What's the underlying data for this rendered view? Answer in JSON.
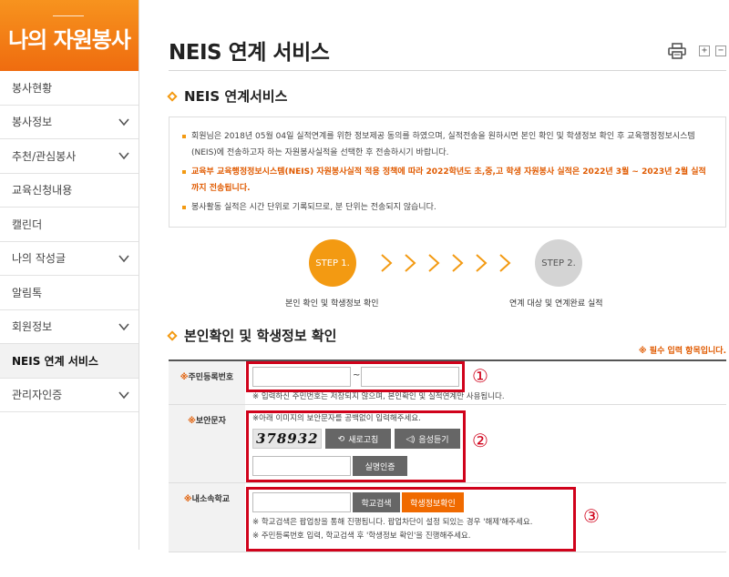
{
  "sidebar": {
    "title": "나의 자원봉사",
    "items": [
      {
        "label": "봉사현황",
        "expandable": false
      },
      {
        "label": "봉사정보",
        "expandable": true
      },
      {
        "label": "추천/관심봉사",
        "expandable": true
      },
      {
        "label": "교육신청내용",
        "expandable": false
      },
      {
        "label": "캘린더",
        "expandable": false
      },
      {
        "label": "나의 작성글",
        "expandable": true
      },
      {
        "label": "알림톡",
        "expandable": false
      },
      {
        "label": "회원정보",
        "expandable": true
      },
      {
        "label": "NEIS 연계 서비스",
        "expandable": false,
        "active": true
      },
      {
        "label": "관리자인증",
        "expandable": true
      }
    ]
  },
  "page": {
    "title": "NEIS 연계 서비스",
    "plus": "+",
    "minus": "−"
  },
  "section1": {
    "title": "NEIS 연계서비스",
    "notices": [
      "회원님은 2018년 05월 04일 실적연계를 위한 정보제공 동의를 하였으며, 실적전송을 원하시면 본인 확인 및 학생정보 확인 후 교육행정정보시스템(NEIS)에 전송하고자 하는 자원봉사실적을 선택한 후 전송하시기 바랍니다.",
      "교육부 교육행정정보시스템(NEIS) 자원봉사실적 적용 정책에 따라 2022학년도 초,중,고 학생 자원봉사 실적은 2022년 3월 ~ 2023년 2월 실적까지 전송됩니다.",
      "봉사활동 실적은 시간 단위로 기록되므로, 분 단위는 전송되지 않습니다."
    ]
  },
  "steps": {
    "step1": "STEP 1.",
    "step2": "STEP 2.",
    "step1_label": "본인 확인 및 학생정보 확인",
    "step2_label": "연계 대상 및 연계완료 실적"
  },
  "section2": {
    "title": "본인확인 및 학생정보 확인",
    "required_note": "※ 필수 입력 항목입니다."
  },
  "form": {
    "rrn": {
      "star": "※",
      "label": "주민등록번호",
      "separator": "~",
      "help": "※ 입력하신 주민번호는 저장되지 않으며, 본인확인 및 실적연계만 사용됩니다."
    },
    "captcha": {
      "star": "※",
      "label": "보안문자",
      "help": "※아래 이미지의 보안문자를 공백없이 입력해주세요.",
      "image_text": "378932",
      "refresh_label": "새로고침",
      "audio_label": "음성듣기",
      "verify_label": "실명인증"
    },
    "school": {
      "star": "※",
      "label": "내소속학교",
      "search_label": "학교검색",
      "student_check_label": "학생정보확인",
      "help1": "※ 학교검색은 팝업창을 통해 진행됩니다. 팝업차단이 설정 되있는 경우 '해제'해주세요.",
      "help2": "※ 주민등록번호 입력, 학교검색 후 '학생정보 확인'을 진행해주세요."
    }
  },
  "annotations": {
    "one": "①",
    "two": "②",
    "three": "③"
  },
  "colors": {
    "accent": "#f39a12",
    "warn": "#e05a00",
    "highlight": "#d0021b"
  }
}
